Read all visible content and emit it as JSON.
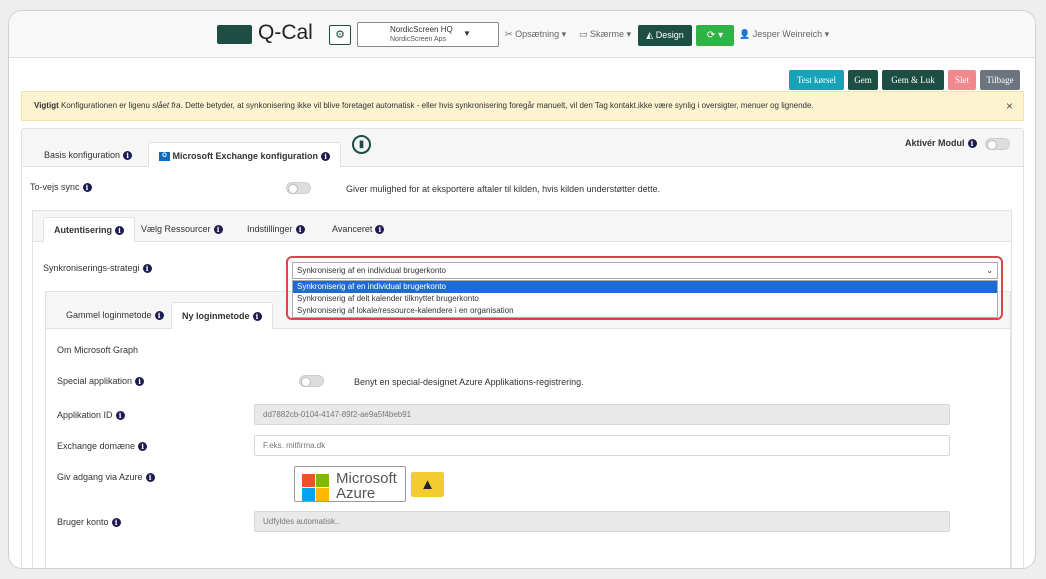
{
  "nav": {
    "logo": "Q-Cal",
    "company_name": "NordicScreen HQ",
    "company_sub": "NordicScreen Aps",
    "setup": "Opsætning",
    "screens": "Skærme",
    "design": "Design",
    "user": "Jesper Weinreich"
  },
  "actions": {
    "test": "Test kørsel",
    "save": "Gem",
    "save_close": "Gem & Luk",
    "delete": "Slet",
    "back": "Tilbage"
  },
  "alert": {
    "strong": "Vigtigt",
    "text1": " Konfigurationen er ligenu ",
    "italic": "slået fra",
    "text2": ". Dette betyder, at synkonisering ikke vil blive foretaget automatisk - eller hvis synkronisering foregår manuelt, vil den Tag kontakt.ikke være synlig i oversigter, menuer og lignende.",
    "close": "×"
  },
  "tabs": {
    "basis": "Basis konfiguration",
    "exchange": "Microsoft Exchange konfiguration",
    "activate": "Aktivér Modul"
  },
  "two_way": {
    "label": "To-vejs sync",
    "desc": "Giver mulighed for at eksportere aftaler til kilden, hvis kilden understøtter dette."
  },
  "subtabs": {
    "auth": "Autentisering",
    "resources": "Vælg Ressourcer",
    "settings": "Indstillinger",
    "advanced": "Avanceret"
  },
  "strategy": {
    "label": "Synkroniserings-strategi",
    "selected": "Synkroniserig af en individual brugerkonto",
    "options": [
      "Synkroniserig af en individual brugerkonto",
      "Synkroniserig af delt kalender tilknyttet brugerkonto",
      "Synkroniserig af lokale/ressource-kalendere i en organisation"
    ]
  },
  "login_tabs": {
    "old": "Gammel loginmetode",
    "new": "Ny loginmetode"
  },
  "form": {
    "about": "Om Microsoft Graph",
    "special_label": "Special applikation",
    "special_desc": "Benyt en special-designet Azure Applikations-registrering.",
    "app_id_label": "Applikation ID",
    "app_id_value": "dd7882cb-0104-4147-89f2-ae9a5f4beb91",
    "domain_label": "Exchange domæne",
    "domain_placeholder": "F.eks. mitfirma.dk",
    "azure_label": "Giv adgang via Azure",
    "azure_line1": "Microsoft",
    "azure_line2": "Azure",
    "user_label": "Bruger konto",
    "user_placeholder": "Udfyldes automatisk.."
  },
  "colors": {
    "brand": "#1d4e43",
    "teal": "#17a2b8",
    "green": "#2fb344",
    "danger": "#e0424c"
  }
}
